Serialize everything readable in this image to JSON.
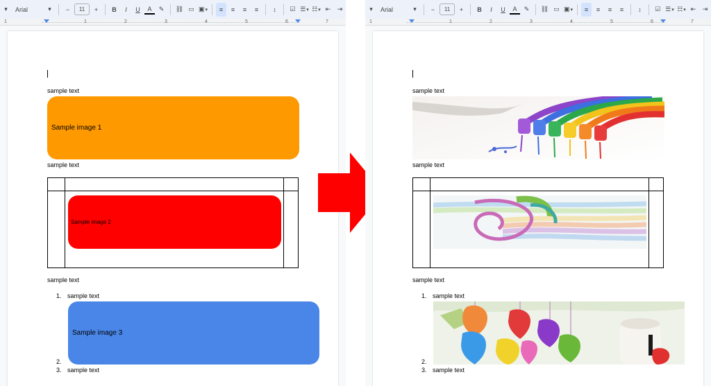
{
  "toolbar": {
    "font": "Arial",
    "font_size": "11",
    "minus": "−",
    "plus": "+",
    "bold": "B",
    "italic": "I",
    "underline": "U",
    "text_color": "A"
  },
  "ruler": {
    "ticks": [
      "1",
      "1",
      "2",
      "3",
      "4",
      "5",
      "6",
      "7"
    ]
  },
  "left_doc": {
    "text_1": "sample text",
    "image_1_label": "Sample image 1",
    "text_2": "sample text",
    "image_2_label": "Sample image 2",
    "text_3": "sample text",
    "list": [
      {
        "num": "1.",
        "text": "sample text"
      },
      {
        "num": "2.",
        "text": ""
      },
      {
        "num": "3.",
        "text": "sample text"
      }
    ],
    "image_3_label": "Sample image 3",
    "colors": {
      "image_1": "#ff9900",
      "image_2": "#ff0000",
      "image_3": "#4a86e8"
    }
  },
  "right_doc": {
    "text_1": "sample text",
    "text_2": "sample text",
    "text_3": "sample text",
    "list": [
      {
        "num": "1.",
        "text": "sample text"
      },
      {
        "num": "2.",
        "text": ""
      },
      {
        "num": "3.",
        "text": "sample text"
      }
    ]
  },
  "arrow_color": "#ff0000"
}
